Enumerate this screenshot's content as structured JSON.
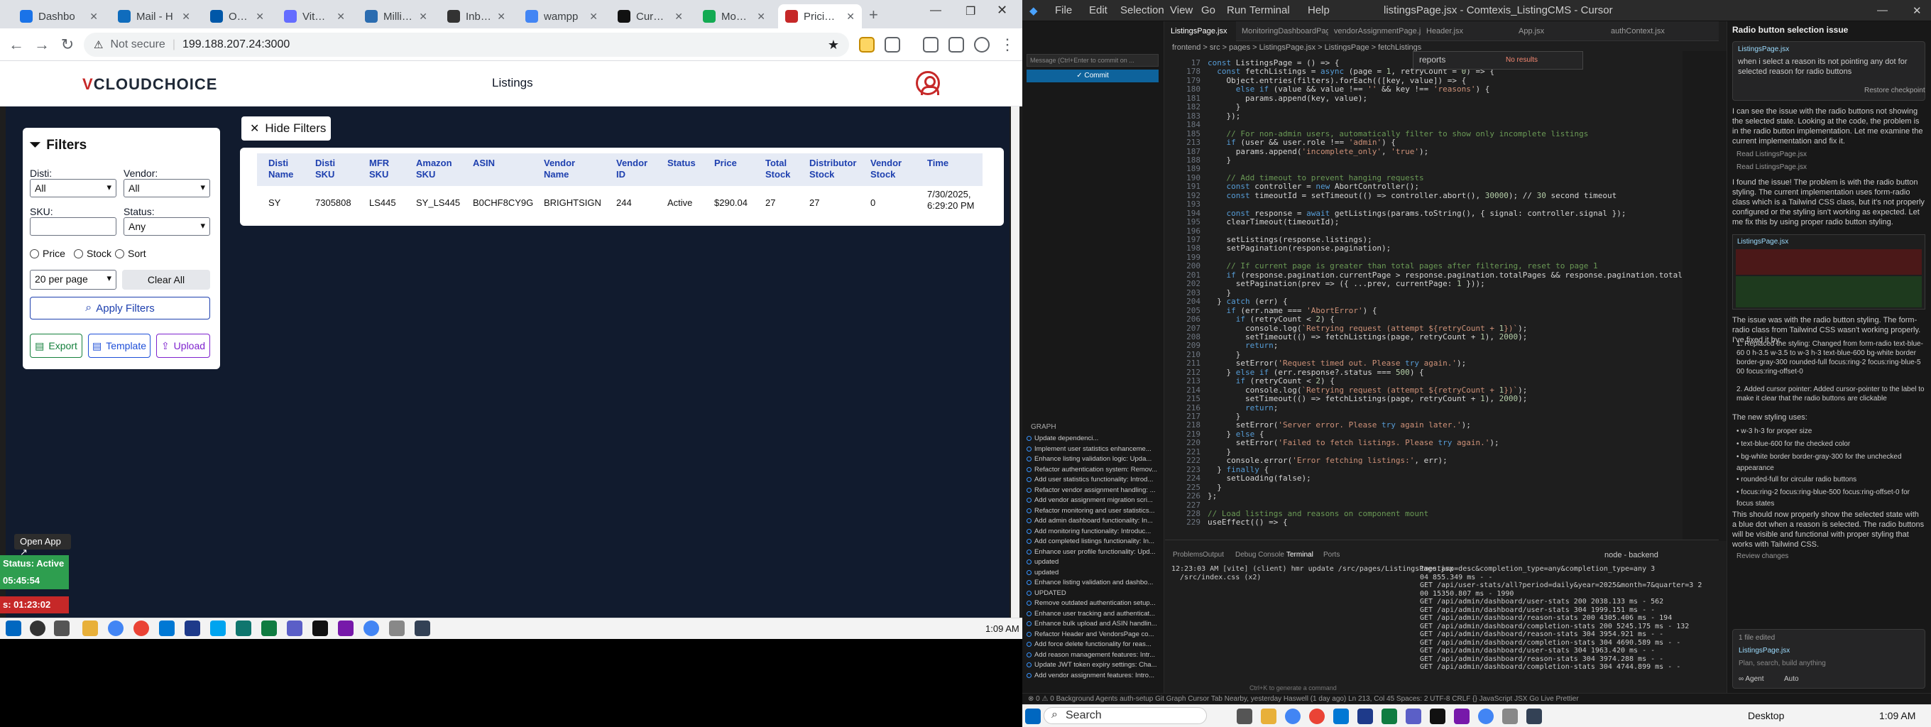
{
  "browser": {
    "tabs": [
      {
        "label": "Dashbo",
        "color": "#1a73e8"
      },
      {
        "label": "Mail - H",
        "color": "#0f6cbd"
      },
      {
        "label": "OTMS M",
        "color": "#0057a8"
      },
      {
        "label": "Vite + Re",
        "color": "#646cff"
      },
      {
        "label": "Millisec",
        "color": "#2b6cb0"
      },
      {
        "label": "Inbox",
        "color": "#333333"
      },
      {
        "label": "wampp",
        "color": "#4285f4"
      },
      {
        "label": "Cursor -",
        "color": "#111111"
      },
      {
        "label": "MongoD",
        "color": "#13aa52"
      },
      {
        "label": "Pricing C",
        "color": "#c62828",
        "active": true
      }
    ],
    "security": "Not secure",
    "url": "199.188.207.24:3000"
  },
  "app": {
    "logo_v": "V",
    "logo_text": "CLOUDCHOICE",
    "page_title": "Listings",
    "hide_filters": "Hide Filters",
    "filters": {
      "title": "Filters",
      "disti_label": "Disti:",
      "disti_value": "All",
      "vendor_label": "Vendor:",
      "vendor_value": "All",
      "sku_label": "SKU:",
      "sku_placeholder": "",
      "status_label": "Status:",
      "status_value": "Any",
      "radio_price": "Price",
      "radio_stock": "Stock",
      "radio_sort": "Sort",
      "per_page": "20 per page",
      "clear_all": "Clear All",
      "apply": "Apply Filters",
      "export": "Export",
      "template": "Template",
      "upload": "Upload"
    },
    "table": {
      "headers": [
        [
          "Disti",
          "Name"
        ],
        [
          "Disti",
          "SKU"
        ],
        [
          "MFR",
          "SKU"
        ],
        [
          "Amazon",
          "SKU"
        ],
        [
          "ASIN"
        ],
        [
          "Vendor",
          "Name"
        ],
        [
          "Vendor",
          "ID"
        ],
        [
          "Status"
        ],
        [
          "Price"
        ],
        [
          "Total",
          "Stock"
        ],
        [
          "Distributor",
          "Stock"
        ],
        [
          "Vendor",
          "Stock"
        ],
        [
          "Time"
        ]
      ],
      "row": [
        "SY",
        "7305808",
        "LS445",
        "SY_LS445",
        "B0CHF8CY9G",
        "BRIGHTSIGN",
        "244",
        "Active",
        "$290.04",
        "27",
        "27",
        "0",
        "7/30/2025,|6:29:20 PM"
      ]
    },
    "open_app": "Open App ↗",
    "status_lines": [
      {
        "text": "Status: Active",
        "color": "#2e9e4f"
      },
      {
        "text": "05:45:54",
        "color": "#2e9e4f"
      },
      {
        "text": "s: 01:23:02",
        "color": "#c62828"
      }
    ]
  },
  "taskbar_left": {
    "time": "1:09 AM"
  },
  "editor": {
    "menu": [
      "File",
      "Edit",
      "Selection",
      "View",
      "Go",
      "Run",
      "Terminal",
      "Help"
    ],
    "title": "listingsPage.jsx - Comtexis_ListingCMS - Cursor",
    "tabs": [
      "ListingsPage.jsx",
      "MonitoringDashboardPage.jsx",
      "vendorAssignmentPage.jsx",
      "Header.jsx",
      "App.jsx",
      "authContext.jsx"
    ],
    "breadcrumb": "frontend > src > pages > ListingsPage.jsx > ListingsPage > fetchListings",
    "find_text": "reports",
    "find_result": "No results",
    "code": [
      {
        "n": "17",
        "t": "const ListingsPage = () => {"
      },
      {
        "n": "",
        "t": "  const fetchListings = async (page = 1, retryCount = 0) => {"
      },
      {
        "n": "",
        "t": "    Object.entries(filters).forEach(([key, value]) => {"
      },
      {
        "n": "",
        "t": "      else if (value && value !== '' && key !== 'reasons') {"
      },
      {
        "n": "",
        "t": "        params.append(key, value);"
      },
      {
        "n": "",
        "t": "      }"
      },
      {
        "n": "",
        "t": "    });"
      },
      {
        "n": "",
        "t": ""
      },
      {
        "n": "",
        "t": "    // For non-admin users, automatically filter to show only incomplete listings"
      },
      {
        "n": "213",
        "t": "    if (user && user.role !== 'admin') {"
      },
      {
        "n": "",
        "t": "      params.append('incomplete_only', 'true');"
      },
      {
        "n": "",
        "t": "    }"
      },
      {
        "n": "",
        "t": ""
      },
      {
        "n": "",
        "t": "    // Add timeout to prevent hanging requests"
      },
      {
        "n": "",
        "t": "    const controller = new AbortController();"
      },
      {
        "n": "",
        "t": "    const timeoutId = setTimeout(() => controller.abort(), 30000); // 30 second timeout"
      },
      {
        "n": "",
        "t": ""
      },
      {
        "n": "",
        "t": "    const response = await getListings(params.toString(), { signal: controller.signal });"
      },
      {
        "n": "",
        "t": "    clearTimeout(timeoutId);"
      },
      {
        "n": "",
        "t": ""
      },
      {
        "n": "",
        "t": "    setListings(response.listings);"
      },
      {
        "n": "",
        "t": "    setPagination(response.pagination);"
      },
      {
        "n": "",
        "t": ""
      },
      {
        "n": "",
        "t": "    // If current page is greater than total pages after filtering, reset to page 1"
      },
      {
        "n": "",
        "t": "    if (response.pagination.currentPage > response.pagination.totalPages && response.pagination.totalPages > 0)"
      },
      {
        "n": "",
        "t": "      setPagination(prev => ({ ...prev, currentPage: 1 }));"
      },
      {
        "n": "",
        "t": "    }"
      },
      {
        "n": "",
        "t": "  } catch (err) {"
      },
      {
        "n": "",
        "t": "    if (err.name === 'AbortError') {"
      },
      {
        "n": "",
        "t": "      if (retryCount < 2) {"
      },
      {
        "n": "",
        "t": "        console.log(`Retrying request (attempt ${retryCount + 1})`);"
      },
      {
        "n": "",
        "t": "        setTimeout(() => fetchListings(page, retryCount + 1), 2000);"
      },
      {
        "n": "",
        "t": "        return;"
      },
      {
        "n": "",
        "t": "      }"
      },
      {
        "n": "",
        "t": "      setError('Request timed out. Please try again.');"
      },
      {
        "n": "",
        "t": "    } else if (err.response?.status === 500) {"
      },
      {
        "n": "",
        "t": "      if (retryCount < 2) {"
      },
      {
        "n": "",
        "t": "        console.log(`Retrying request (attempt ${retryCount + 1})`);"
      },
      {
        "n": "",
        "t": "        setTimeout(() => fetchListings(page, retryCount + 1), 2000);"
      },
      {
        "n": "",
        "t": "        return;"
      },
      {
        "n": "",
        "t": "      }"
      },
      {
        "n": "",
        "t": "      setError('Server error. Please try again later.');"
      },
      {
        "n": "",
        "t": "    } else {"
      },
      {
        "n": "",
        "t": "      setError('Failed to fetch listings. Please try again.');"
      },
      {
        "n": "",
        "t": "    }"
      },
      {
        "n": "",
        "t": "    console.error('Error fetching listings:', err);"
      },
      {
        "n": "",
        "t": "  } finally {"
      },
      {
        "n": "",
        "t": "    setLoading(false);"
      },
      {
        "n": "",
        "t": "  }"
      },
      {
        "n": "",
        "t": "};"
      },
      {
        "n": "",
        "t": ""
      },
      {
        "n": "",
        "t": "// Load listings and reasons on component mount"
      },
      {
        "n": "",
        "t": "useEffect(() => {"
      }
    ],
    "scm": {
      "input_placeholder": "Message (Ctrl+Enter to commit on ...",
      "commit": "✓ Commit",
      "graph_label": "GRAPH",
      "commits": [
        "Update dependenci...",
        "Implement user statistics enhanceme...",
        "Enhance listing validation logic: Upda...",
        "Refactor authentication system: Remov...",
        "Add user statistics functionality: Introd...",
        "Refactor vendor assignment handling: ...",
        "Add vendor assignment migration scri...",
        "Refactor monitoring and user statistics...",
        "Add admin dashboard functionality: In...",
        "Add monitoring functionality: Introduc...",
        "Add completed listings functionality: In...",
        "Enhance user profile functionality: Upd...",
        "updated",
        "updated",
        "Enhance listing validation and dashbo...",
        "UPDATED",
        "Remove outdated authentication setup...",
        "Enhance user tracking and authenticat...",
        "Enhance bulk upload and ASIN handlin...",
        "Refactor Header and VendorsPage co...",
        "Add force delete functionality for reas...",
        "Add reason management features: Intr...",
        "Update JWT token expiry settings: Cha...",
        "Add vendor assignment features: Intro..."
      ]
    },
    "terminal": {
      "tabs": [
        "Problems",
        "Output",
        "Debug Console",
        "Terminal",
        "Ports"
      ],
      "session": "node - backend",
      "left_lines": [
        "12:23:03 AM [vite] (client) hmr update /src/pages/ListingsPage.jsx",
        "  /src/index.css (x2)"
      ],
      "right_lines": [
        "1mestamp=desc&completion_type=any&completion_type=any 3",
        "04 855.349 ms - -",
        "GET /api/user-stats/all?period=daily&year=2025&month=7&quarter=3 2",
        "00 15350.807 ms - 1990",
        "GET /api/admin/dashboard/user-stats 200 2038.133 ms - 562",
        "GET /api/admin/dashboard/user-stats 304 1999.151 ms - -",
        "GET /api/admin/dashboard/reason-stats 200 4305.406 ms - 194",
        "GET /api/admin/dashboard/completion-stats 200 5245.175 ms - 132",
        "GET /api/admin/dashboard/reason-stats 304 3954.921 ms - -",
        "GET /api/admin/dashboard/completion-stats 304 4690.589 ms - -",
        "GET /api/admin/dashboard/user-stats 304 1963.420 ms - -",
        "GET /api/admin/dashboard/reason-stats 304 3974.288 ms - -",
        "GET /api/admin/dashboard/completion-stats 304 4744.899 ms - -"
      ],
      "hint": "Ctrl+K to generate a command"
    },
    "chat": {
      "title": "Radio button selection issue",
      "file_chip": "ListingsPage.jsx",
      "user_msg": "when i select a reason its not pointing any dot for selected reason for radio buttons",
      "restore": "Restore checkpoint",
      "p1": "I can see the issue with the radio buttons not showing the selected state. Looking at the code, the problem is in the radio button implementation. Let me examine the current implementation and fix it.",
      "read1": "Read ListingsPage.jsx",
      "read2": "Read ListingsPage.jsx",
      "p2": "I found the issue! The problem is with the radio button styling. The current implementation uses form-radio class which is a Tailwind CSS class, but it's not properly configured or the styling isn't working as expected. Let me fix this by using proper radio button styling.",
      "file_chip2": "ListingsPage.jsx",
      "p3": "The issue was with the radio button styling. The form-radio class from Tailwind CSS wasn't working properly. I've fixed it by:",
      "li1": "1. Replaced the styling: Changed from form-radio text-blue-60 0 h-3.5 w-3.5 to w-3 h-3 text-blue-600 bg-white border border-gray-300 rounded-full focus:ring-2 focus:ring-blue-5 00 focus:ring-offset-0",
      "li2": "2. Added cursor pointer: Added cursor-pointer to the label to make it clear that the radio buttons are clickable",
      "p4": "The new styling uses:",
      "b1": "• w-3 h-3 for proper size",
      "b2": "• text-blue-600 for the checked color",
      "b3": "• bg-white border border-gray-300 for the unchecked appearance",
      "b4": "• rounded-full for circular radio buttons",
      "b5": "• focus:ring-2 focus:ring-blue-500 focus:ring-offset-0 for focus states",
      "p5": "This should now properly show the selected state with a blue dot when a reason is selected. The radio buttons will be visible and functional with proper styling that works with Tailwind CSS.",
      "review": "Review changes",
      "files_edited": "1 file edited",
      "plan_placeholder": "Plan, search, build anything",
      "agent": "∞ Agent",
      "auto": "Auto"
    },
    "statusbar": "⊗ 0 ⚠ 0    Background Agents    auth-setup    Git Graph    Cursor Tab    Nearby, yesterday    Haswell (1 day ago)    Ln 213, Col 45    Spaces: 2    UTF-8    CRLF    {} JavaScript JSX    Go Live    Prettier"
  },
  "taskbar_right": {
    "search": "Search",
    "desktop": "Desktop",
    "time": "1:09 AM"
  }
}
